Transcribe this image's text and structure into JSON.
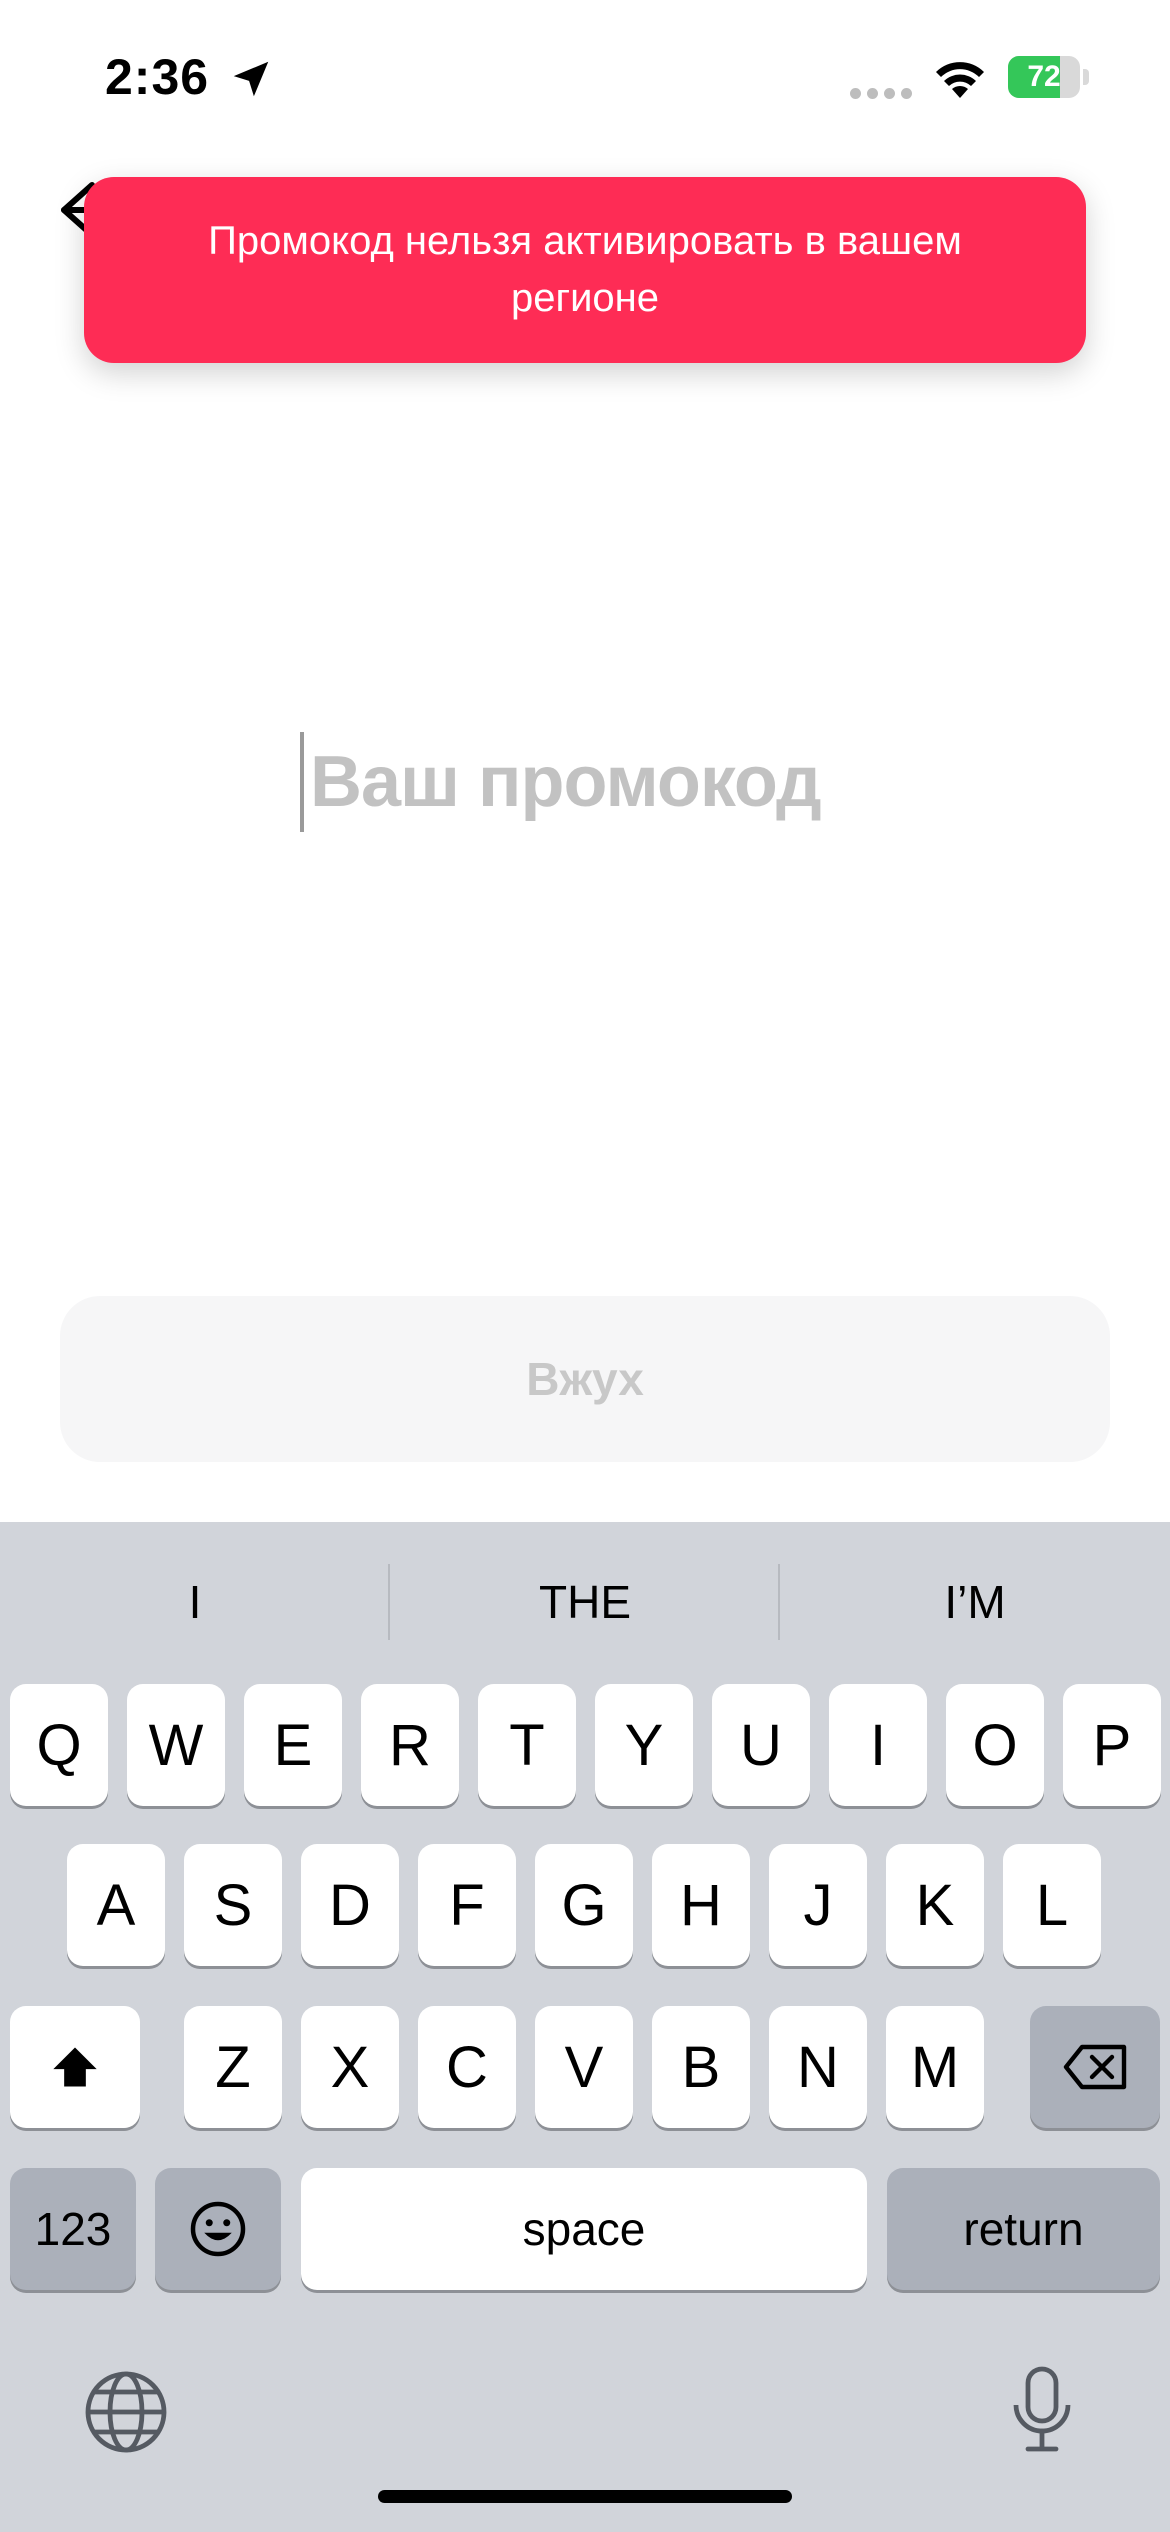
{
  "status_bar": {
    "time": "2:36",
    "battery_percent": "72"
  },
  "toast": {
    "message": "Промокод нельзя активировать в вашем регионе"
  },
  "promo": {
    "placeholder": "Ваш промокод"
  },
  "submit": {
    "label": "Вжух"
  },
  "keyboard": {
    "suggestions": [
      "I",
      "THE",
      "I’M"
    ],
    "row1": [
      "Q",
      "W",
      "E",
      "R",
      "T",
      "Y",
      "U",
      "I",
      "O",
      "P"
    ],
    "row2": [
      "A",
      "S",
      "D",
      "F",
      "G",
      "H",
      "J",
      "K",
      "L"
    ],
    "row3": [
      "Z",
      "X",
      "C",
      "V",
      "B",
      "N",
      "M"
    ],
    "numbers_label": "123",
    "space_label": "space",
    "return_label": "return"
  },
  "colors": {
    "toast": "#fe2c55",
    "battery": "#34c759",
    "keyboard_bg": "#d1d4da"
  }
}
